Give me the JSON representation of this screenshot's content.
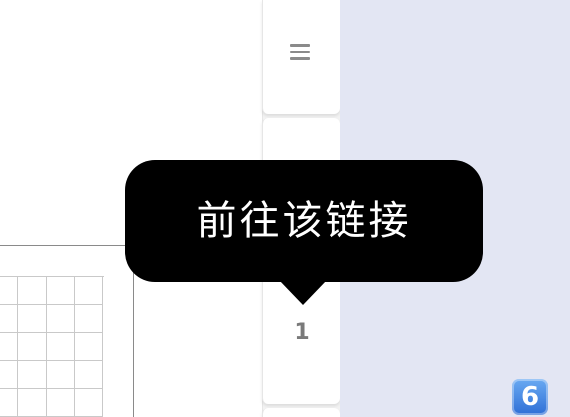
{
  "tooltip": {
    "text": "前往该链接"
  },
  "sidebar": {
    "menu_icon": "hamburger-icon",
    "page_number": "1"
  },
  "badge": {
    "icon": "keycap-digit-icon",
    "label": "6"
  },
  "colors": {
    "tooltip_bg": "#000000",
    "tooltip_text": "#ffffff",
    "right_panel_bg": "#e3e6f3",
    "page_number": "#7a7a7a",
    "badge_bg": "#2f6fd6"
  }
}
